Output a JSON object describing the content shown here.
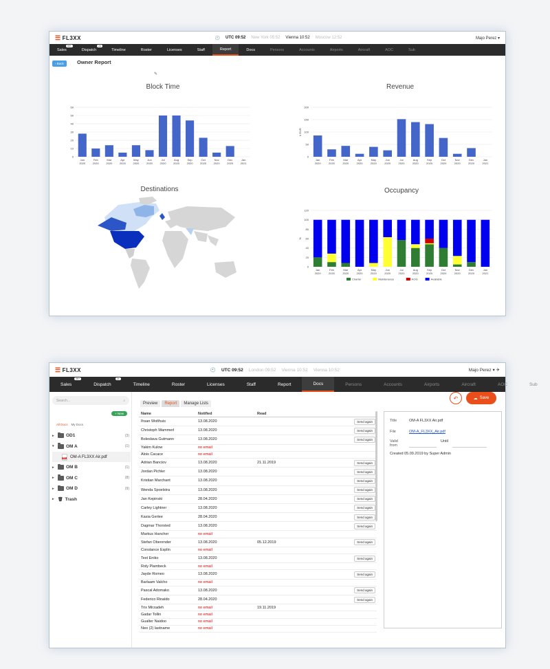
{
  "header": {
    "logo": "FL3XX",
    "utc": "UTC 09:52",
    "w1_c1": "New York 05:52",
    "w1_c2": "Vienna 10:52",
    "w1_c3": "Moscow 12:52",
    "w2_c1": "London 09:52",
    "w2_c2": "Vienna 10:52",
    "w2_c3": "Vienna 10:52",
    "user": "Majo Perez"
  },
  "nav": {
    "items": [
      {
        "label": "Sales",
        "badge": "99+"
      },
      {
        "label": "Dispatch",
        "badge": "24"
      },
      {
        "label": "Timeline"
      },
      {
        "label": "Roster"
      },
      {
        "label": "Licenses"
      },
      {
        "label": "Staff"
      },
      {
        "label": "Report"
      },
      {
        "label": "Docs"
      },
      {
        "label": "Persons"
      },
      {
        "label": "Accounts"
      },
      {
        "label": "Airports"
      },
      {
        "label": "Aircraft"
      },
      {
        "label": "AOC"
      },
      {
        "label": "Sub"
      }
    ]
  },
  "report": {
    "back": "‹ Back",
    "title": "Owner Report"
  },
  "chart_data": [
    {
      "type": "bar",
      "title": "Block Time",
      "categories": [
        "Jan 2020",
        "Feb 2020",
        "Mar 2020",
        "Apr 2020",
        "May 2020",
        "Jun 2020",
        "Jul 2020",
        "Aug 2020",
        "Sep 2020",
        "Oct 2020",
        "Nov 2020",
        "Dec 2020",
        "Jan 2021"
      ],
      "values": [
        28,
        10,
        14,
        5,
        14,
        8,
        50,
        50,
        44,
        23,
        5,
        13,
        0
      ],
      "ylim": [
        0,
        60
      ],
      "yticks": [
        0,
        10,
        20,
        30,
        40,
        50,
        60
      ],
      "color": "#4466c8"
    },
    {
      "type": "bar",
      "title": "Revenue",
      "ylabel": "k EUR",
      "categories": [
        "Jan 2020",
        "Feb 2020",
        "Mar 2020",
        "Apr 2020",
        "May 2020",
        "Jun 2020",
        "Jul 2020",
        "Aug 2020",
        "Sep 2020",
        "Oct 2020",
        "Nov 2020",
        "Dec 2020",
        "Jan 2021"
      ],
      "values": [
        86,
        30,
        44,
        12,
        40,
        26,
        152,
        140,
        132,
        76,
        12,
        35,
        0
      ],
      "ylim": [
        0,
        200
      ],
      "yticks": [
        0,
        50,
        100,
        150,
        200
      ],
      "color": "#4466c8"
    },
    {
      "type": "bar",
      "title": "Occupancy",
      "ylabel": "%",
      "categories": [
        "Jan 2020",
        "Feb 2020",
        "Mar 2020",
        "Apr 2020",
        "May 2020",
        "Jun 2020",
        "Jul 2020",
        "Aug 2020",
        "Sep 2020",
        "Oct 2020",
        "Nov 2020",
        "Dec 2020",
        "Jan 2021"
      ],
      "ylim": [
        0,
        120
      ],
      "yticks": [
        0,
        20,
        40,
        60,
        80,
        100,
        120
      ],
      "series": [
        {
          "name": "Charter",
          "color": "#2e7d32",
          "values": [
            20,
            10,
            8,
            0,
            0,
            0,
            57,
            40,
            48,
            40,
            5,
            10,
            0
          ]
        },
        {
          "name": "Maintenance",
          "color": "#ffff33",
          "values": [
            0,
            18,
            0,
            0,
            8,
            63,
            0,
            8,
            2,
            0,
            18,
            0,
            0
          ]
        },
        {
          "name": "AOG",
          "color": "#cc0000",
          "values": [
            0,
            0,
            0,
            0,
            0,
            0,
            0,
            0,
            10,
            0,
            0,
            0,
            0
          ]
        },
        {
          "name": "Available",
          "color": "#0000ee",
          "values": [
            80,
            72,
            92,
            100,
            92,
            37,
            43,
            52,
            40,
            60,
            77,
            90,
            100
          ]
        }
      ],
      "legend": "bottom"
    }
  ],
  "map_title": "Destinations",
  "docs": {
    "search_placeholder": "Search...",
    "new": "+ New",
    "tab_all": "All Docs",
    "tab_my": "My Docs",
    "folders": [
      {
        "name": "OD1",
        "count": "(3)"
      },
      {
        "name": "OM A",
        "count": "(1)"
      },
      {
        "name": "OM B",
        "count": "(1)"
      },
      {
        "name": "OM C",
        "count": "(8)"
      },
      {
        "name": "OM D",
        "count": "(9)"
      },
      {
        "name": "Trash",
        "count": ""
      }
    ],
    "file": "OM-A FL3XX Air.pdf",
    "subtabs": [
      "Preview",
      "Report",
      "Manage Lists"
    ],
    "save": "Save",
    "columns": [
      "Name",
      "Notified",
      "Read"
    ],
    "send_label": "Send again",
    "rows": [
      [
        "Ihsan Wolthuis",
        "13.08.2020",
        "",
        true
      ],
      [
        "Christoph Wammerl",
        "13.08.2020",
        "",
        true
      ],
      [
        "Boleslava Gutmann",
        "13.08.2020",
        "",
        true
      ],
      [
        "Yakim Kulow",
        "no email",
        "",
        false
      ],
      [
        "Alois Cacace",
        "no email",
        "",
        false
      ],
      [
        "Adrian Banciov",
        "13.08.2020",
        "21.11.2019",
        true
      ],
      [
        "Jordan Pichler",
        "13.08.2020",
        "",
        true
      ],
      [
        "Kristian Marchant",
        "13.08.2020",
        "",
        true
      ],
      [
        "Wenda Spoelstra",
        "13.08.2020",
        "",
        true
      ],
      [
        "Jan Kepinski",
        "28.04.2020",
        "",
        true
      ],
      [
        "Carley Lightner",
        "13.08.2020",
        "",
        true
      ],
      [
        "Kasia Gerlee",
        "28.04.2020",
        "",
        true
      ],
      [
        "Dagmar Thorsted",
        "13.08.2020",
        "",
        true
      ],
      [
        "Markus Hancher",
        "no email",
        "",
        false
      ],
      [
        "Stefan Oberender",
        "13.08.2020",
        "05.12.2019",
        true
      ],
      [
        "Constance Esplin",
        "no email",
        "",
        false
      ],
      [
        "Test Eniko",
        "13.08.2020",
        "",
        true
      ],
      [
        "Roly Plambeck",
        "no email",
        "",
        false
      ],
      [
        "Jayde Romeo",
        "13.08.2020",
        "",
        true
      ],
      [
        "Barlaam Valcho",
        "no email",
        "",
        false
      ],
      [
        "Pascal Adomako",
        "13.08.2020",
        "",
        true
      ],
      [
        "Federico Rinaldo",
        "28.04.2020",
        "",
        true
      ],
      [
        "Trix Mirzadeh",
        "no email",
        "19.11.2019",
        false
      ],
      [
        "Gadar Tollin",
        "no email",
        "",
        false
      ],
      [
        "Gualter Naidoo",
        "no email",
        "",
        false
      ],
      [
        "Neo (2) lastname",
        "no email",
        "",
        false
      ]
    ],
    "panel": {
      "title_label": "Title",
      "title_val": "OM-A FL3XX Air.pdf",
      "file_label": "File",
      "file_val": "OM-A_FL3XX_Air.pdf",
      "valid_label": "Valid from",
      "until_label": "Until",
      "created": "Created 05.09.2019 by Super Admin"
    }
  }
}
